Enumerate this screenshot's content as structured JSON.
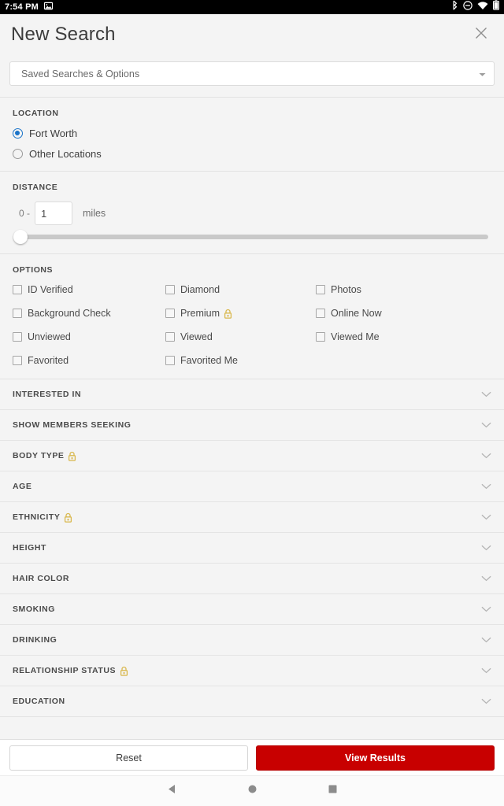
{
  "statusbar": {
    "clock": "7:54 PM",
    "left_icons": [
      "image-icon"
    ],
    "right_icons": [
      "bluetooth-icon",
      "do-not-disturb-icon",
      "wifi-icon",
      "battery-icon"
    ]
  },
  "header": {
    "title": "New Search",
    "close_icon": "close-icon"
  },
  "saved_searches": {
    "label": "Saved Searches & Options",
    "caret_icon": "chevron-down-icon"
  },
  "location": {
    "title": "LOCATION",
    "options": [
      {
        "label": "Fort Worth",
        "checked": true
      },
      {
        "label": "Other Locations",
        "checked": false
      }
    ]
  },
  "distance": {
    "title": "DISTANCE",
    "prefix": "0 -",
    "value": "1",
    "placeholder": "1",
    "unit": "miles",
    "slider_value": 0
  },
  "options": {
    "title": "OPTIONS",
    "items": [
      {
        "label": "ID Verified",
        "checked": false,
        "locked": false
      },
      {
        "label": "Diamond",
        "checked": false,
        "locked": false
      },
      {
        "label": "Photos",
        "checked": false,
        "locked": false
      },
      {
        "label": "Background Check",
        "checked": false,
        "locked": false
      },
      {
        "label": "Premium",
        "checked": false,
        "locked": true
      },
      {
        "label": "Online Now",
        "checked": false,
        "locked": false
      },
      {
        "label": "Unviewed",
        "checked": false,
        "locked": false
      },
      {
        "label": "Viewed",
        "checked": false,
        "locked": false
      },
      {
        "label": "Viewed Me",
        "checked": false,
        "locked": false
      },
      {
        "label": "Favorited",
        "checked": false,
        "locked": false
      },
      {
        "label": "Favorited Me",
        "checked": false,
        "locked": false
      }
    ]
  },
  "accordions": [
    {
      "label": "INTERESTED IN",
      "locked": false
    },
    {
      "label": "SHOW MEMBERS SEEKING",
      "locked": false
    },
    {
      "label": "BODY TYPE",
      "locked": true
    },
    {
      "label": "AGE",
      "locked": false
    },
    {
      "label": "ETHNICITY",
      "locked": true
    },
    {
      "label": "HEIGHT",
      "locked": false
    },
    {
      "label": "HAIR COLOR",
      "locked": false
    },
    {
      "label": "SMOKING",
      "locked": false
    },
    {
      "label": "DRINKING",
      "locked": false
    },
    {
      "label": "RELATIONSHIP STATUS",
      "locked": true
    },
    {
      "label": "EDUCATION",
      "locked": false
    }
  ],
  "bottom": {
    "reset_label": "Reset",
    "view_results_label": "View Results",
    "accent_color": "#c80000"
  },
  "navbar": {
    "back_icon": "back-triangle-icon",
    "home_icon": "home-circle-icon",
    "recents_icon": "recents-square-icon"
  },
  "colors": {
    "accent_red": "#c80000",
    "radio_blue": "#1a73c8",
    "lock_gold": "#d8b martyr"
  }
}
